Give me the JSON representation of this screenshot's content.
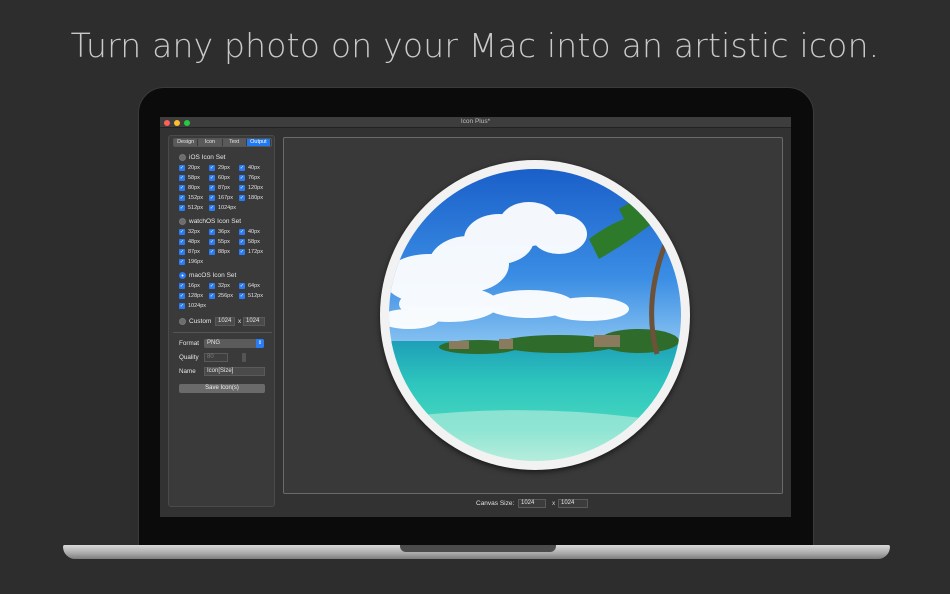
{
  "headline": "Turn any photo on your Mac into an artistic icon.",
  "window": {
    "title": "Icon Plus*",
    "traffic_lights": {
      "close": "#fe5f57",
      "minimize": "#febc2e",
      "zoom": "#28c840"
    }
  },
  "tabs": [
    "Design",
    "Icon",
    "Text",
    "Output"
  ],
  "active_tab": "Output",
  "ios": {
    "label": "iOS Icon Set",
    "selected": false,
    "sizes": [
      "20px",
      "29px",
      "40px",
      "58px",
      "60px",
      "76px",
      "80px",
      "87px",
      "120px",
      "152px",
      "167px",
      "180px",
      "512px",
      "1024px"
    ]
  },
  "watchos": {
    "label": "watchOS Icon Set",
    "selected": false,
    "sizes": [
      "32px",
      "36px",
      "40px",
      "48px",
      "55px",
      "58px",
      "87px",
      "88px",
      "172px",
      "196px"
    ]
  },
  "macos": {
    "label": "macOS Icon Set",
    "selected": true,
    "sizes": [
      "16px",
      "32px",
      "64px",
      "128px",
      "256px",
      "512px",
      "1024px"
    ]
  },
  "custom": {
    "label": "Custom",
    "width": "1024",
    "x": "x",
    "height": "1024"
  },
  "format": {
    "label": "Format",
    "value": "PNG"
  },
  "quality": {
    "label": "Quality",
    "value": "80"
  },
  "name": {
    "label": "Name",
    "value": "Icon[Size]"
  },
  "save_button": "Save Icon(s)",
  "canvas_size": {
    "label": "Canvas Size:",
    "width": "1024",
    "x": "x",
    "height": "1024"
  },
  "check_mark": "✓",
  "accent": "#2a7cf5"
}
